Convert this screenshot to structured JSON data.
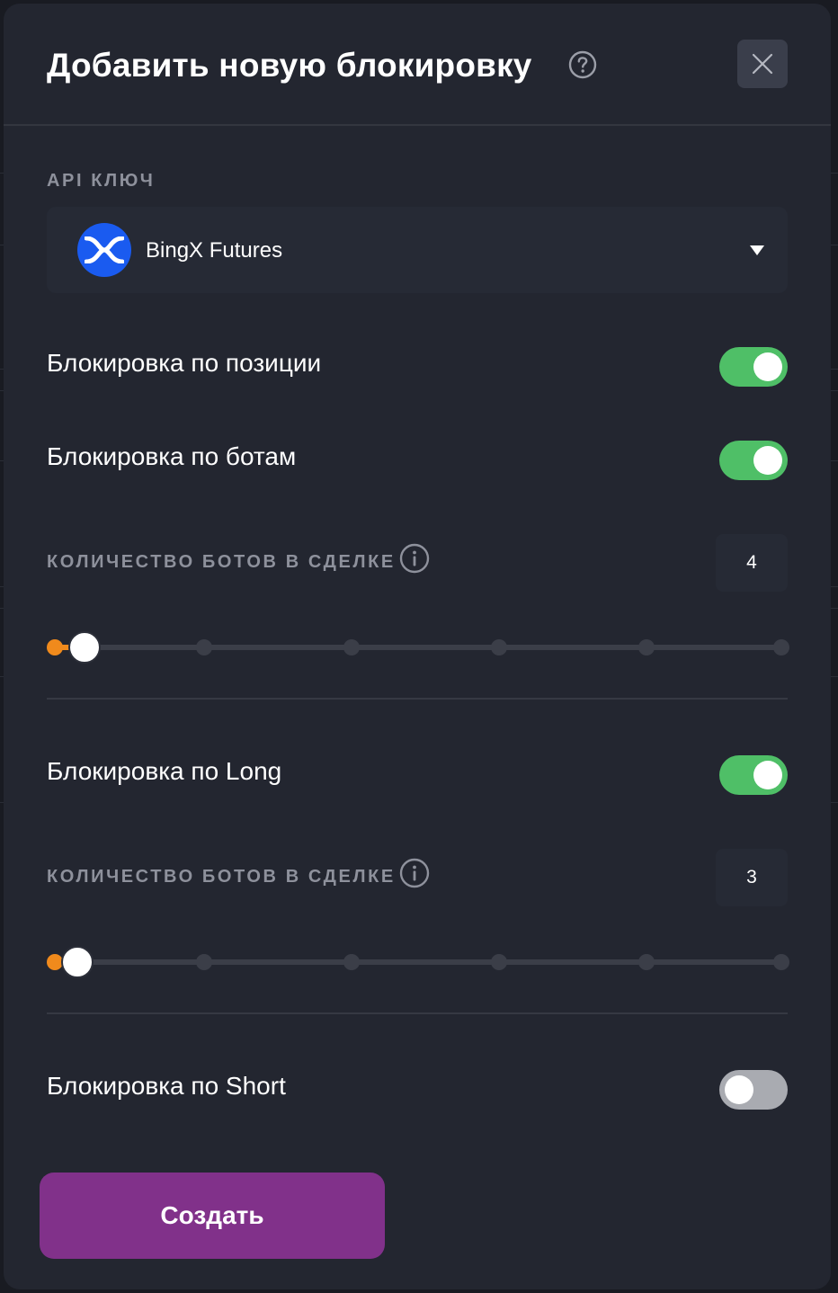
{
  "modal": {
    "title": "Добавить новую блокировку",
    "api_key_label": "API КЛЮЧ",
    "api_key_selected": "BingX Futures",
    "create_label": "Создать"
  },
  "position_lock": {
    "label": "Блокировка по позиции",
    "enabled": true
  },
  "bots_lock": {
    "label": "Блокировка по ботам",
    "enabled": true,
    "count_label": "КОЛИЧЕСТВО БОТОВ В СДЕЛКЕ",
    "count": "4"
  },
  "long_lock": {
    "label": "Блокировка по Long",
    "enabled": true,
    "count_label": "КОЛИЧЕСТВО БОТОВ В СДЕЛКЕ",
    "count": "3"
  },
  "short_lock": {
    "label": "Блокировка по Short",
    "enabled": false
  },
  "colors": {
    "toggle_on": "#4fbf67",
    "toggle_off": "#a9abb1",
    "slider_accent": "#f08a1c",
    "create_button": "#81318a",
    "brand_logo": "#1a5bf0"
  },
  "icons": [
    "help-icon",
    "close-icon",
    "bingx-logo-icon",
    "info-icon",
    "caret-down-icon"
  ]
}
